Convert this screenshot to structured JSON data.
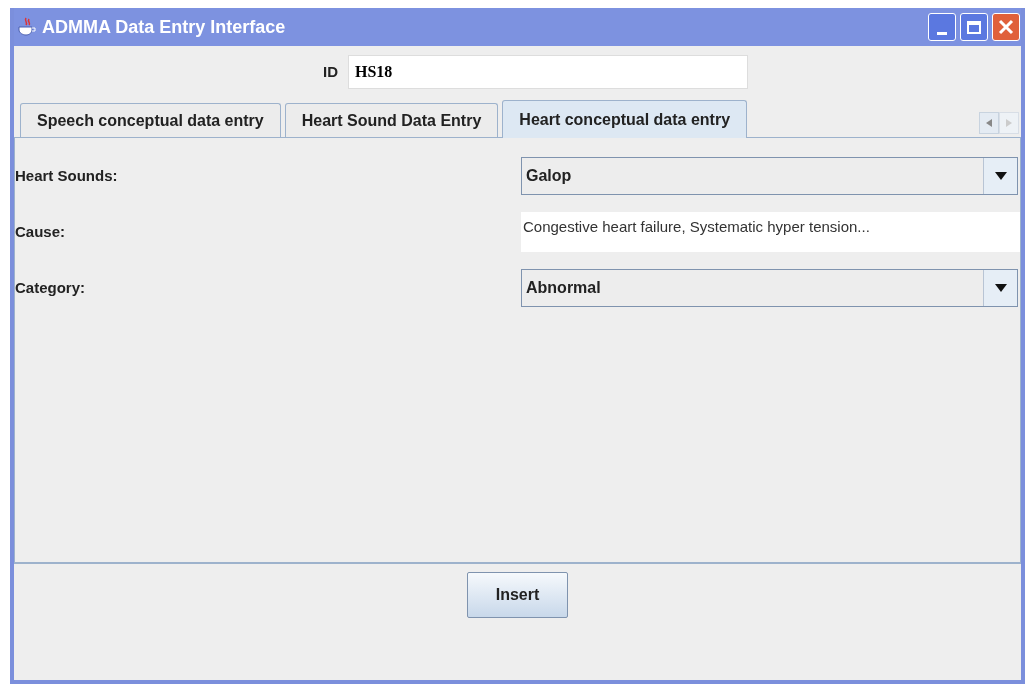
{
  "window": {
    "title": "ADMMA Data Entry Interface"
  },
  "id_field": {
    "label": "ID",
    "value": "HS18"
  },
  "tabs": [
    {
      "label": "Speech conceptual data entry",
      "selected": false
    },
    {
      "label": "Heart Sound Data Entry",
      "selected": false
    },
    {
      "label": "Heart conceptual data entry",
      "selected": true
    }
  ],
  "fields": [
    {
      "label": "Heart Sounds:",
      "kind": "combo",
      "value": "Galop"
    },
    {
      "label": "Cause:",
      "kind": "text",
      "value": "Congestive heart failure, Systematic hyper tension..."
    },
    {
      "label": "Category:",
      "kind": "combo",
      "value": "Abnormal"
    }
  ],
  "buttons": [
    "Insert"
  ]
}
